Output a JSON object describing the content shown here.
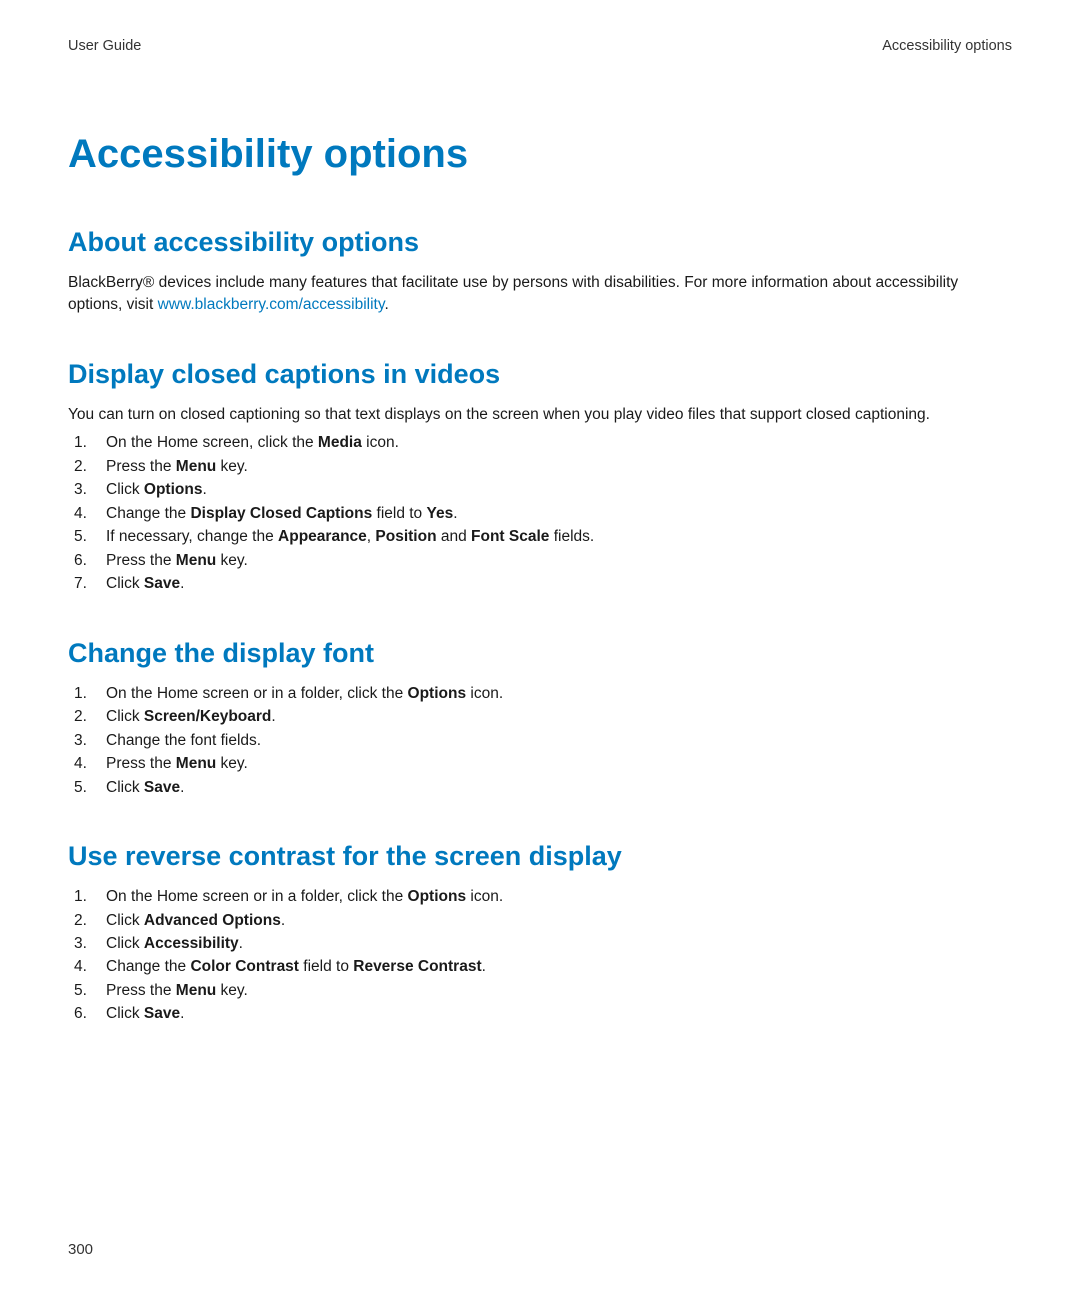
{
  "header": {
    "left": "User Guide",
    "right": "Accessibility options"
  },
  "title": "Accessibility options",
  "sections": {
    "about": {
      "heading": "About accessibility options",
      "intro_pre": "BlackBerry® devices include many features that facilitate use by persons with disabilities. For more information about accessibility options, visit ",
      "intro_link_text": "www.blackberry.com/accessibility",
      "intro_link_href": "http://www.blackberry.com/accessibility",
      "intro_post": "."
    },
    "captions": {
      "heading": "Display closed captions in videos",
      "intro": "You can turn on closed captioning so that text displays on the screen when you play video files that support closed captioning.",
      "steps": [
        "On the Home screen, click the <b>Media</b> icon.",
        "Press the <b>Menu</b> key.",
        "Click <b>Options</b>.",
        "Change the <b>Display Closed Captions</b> field to <b>Yes</b>.",
        "If necessary, change the <b>Appearance</b>, <b>Position</b> and <b>Font Scale</b> fields.",
        "Press the <b>Menu</b> key.",
        "Click <b>Save</b>."
      ]
    },
    "font": {
      "heading": "Change the display font",
      "steps": [
        "On the Home screen or in a folder, click the <b>Options</b> icon.",
        "Click <b>Screen/Keyboard</b>.",
        "Change the font fields.",
        "Press the <b>Menu</b> key.",
        "Click <b>Save</b>."
      ]
    },
    "contrast": {
      "heading": "Use reverse contrast for the screen display",
      "steps": [
        "On the Home screen or in a folder, click the <b>Options</b> icon.",
        "Click <b>Advanced Options</b>.",
        "Click <b>Accessibility</b>.",
        "Change the <b>Color Contrast</b> field to <b>Reverse Contrast</b>.",
        "Press the <b>Menu</b> key.",
        "Click <b>Save</b>."
      ]
    }
  },
  "page_number": "300"
}
